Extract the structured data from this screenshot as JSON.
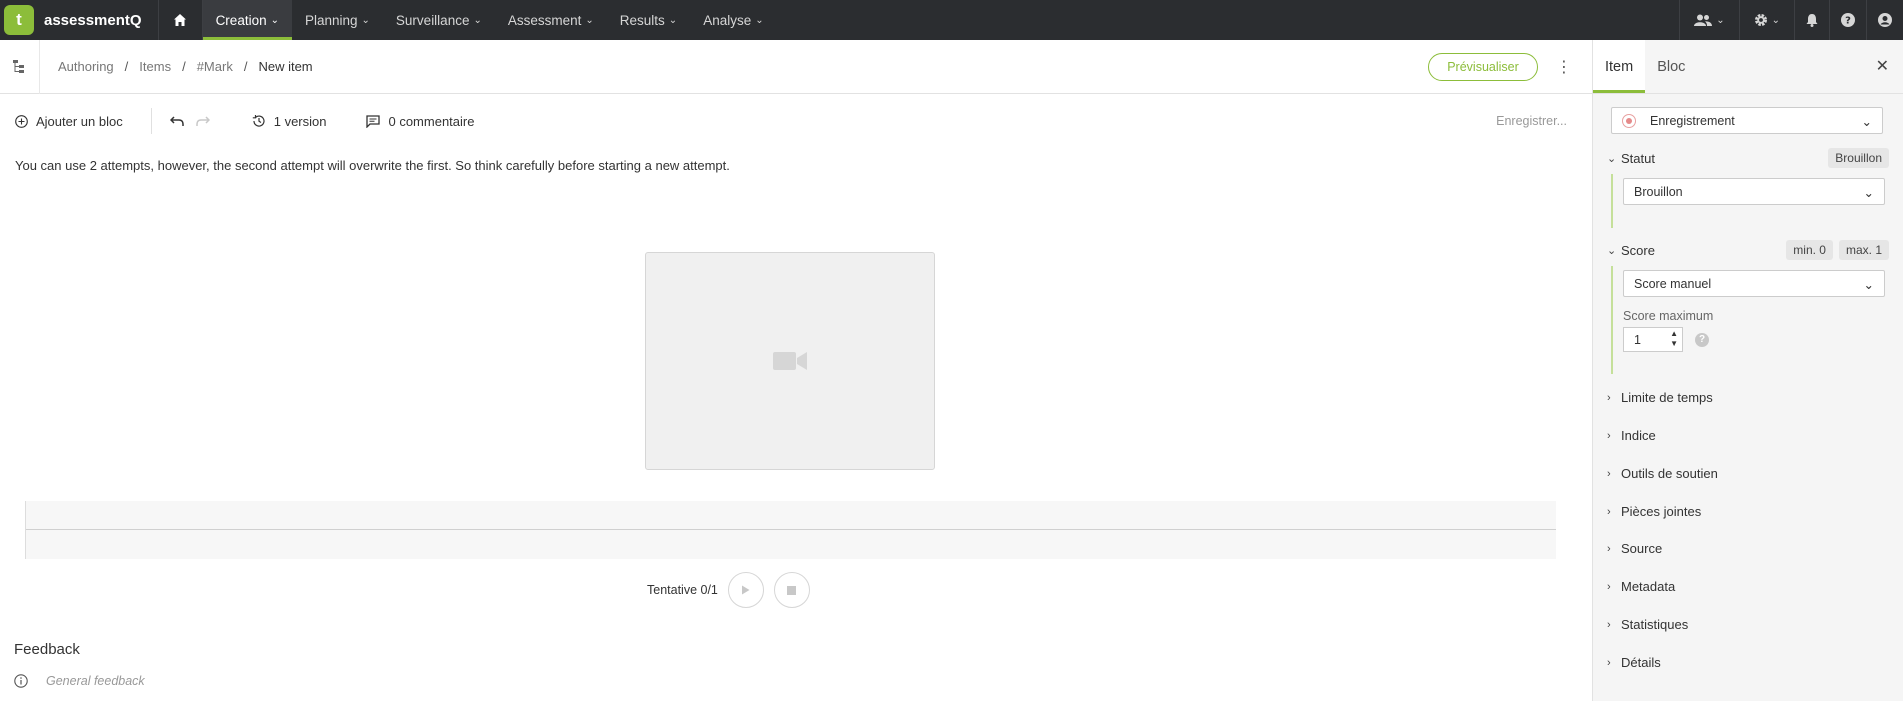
{
  "nav": {
    "brand": "assessmentQ",
    "logo_letter": "t",
    "items": [
      {
        "label": "Creation",
        "active": true
      },
      {
        "label": "Planning"
      },
      {
        "label": "Surveillance"
      },
      {
        "label": "Assessment"
      },
      {
        "label": "Results"
      },
      {
        "label": "Analyse"
      }
    ]
  },
  "breadcrumb": {
    "items": [
      "Authoring",
      "Items",
      "#Mark"
    ],
    "current": "New item"
  },
  "header": {
    "preview_label": "Prévisualiser"
  },
  "toolbar": {
    "add_block_label": "Ajouter un bloc",
    "versions_label": "1 version",
    "comments_label": "0 commentaire",
    "saving_status": "Enregistrer..."
  },
  "content": {
    "instructions": "You can use 2 attempts, however, the second attempt will overwrite the first. So think carefully before starting a new attempt.",
    "attempt_label": "Tentative 0/1",
    "feedback_title": "Feedback",
    "feedback_placeholder": "General feedback"
  },
  "panel": {
    "tabs": [
      "Item",
      "Bloc"
    ],
    "type_select": "Enregistrement",
    "status": {
      "title": "Statut",
      "badge": "Brouillon",
      "select": "Brouillon"
    },
    "score": {
      "title": "Score",
      "min_badge": "min. 0",
      "max_badge": "max. 1",
      "select": "Score manuel",
      "max_label": "Score maximum",
      "max_value": "1",
      "help": "?"
    },
    "sections": [
      "Limite de temps",
      "Indice",
      "Outils de soutien",
      "Pièces jointes",
      "Source",
      "Metadata",
      "Statistiques",
      "Détails"
    ]
  },
  "colors": {
    "accent": "#8cbd3a",
    "nav_bg": "#2b2d30"
  }
}
